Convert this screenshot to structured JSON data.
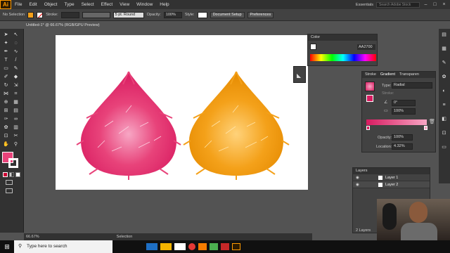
{
  "app": {
    "logo": "Ai",
    "menus": [
      "File",
      "Edit",
      "Object",
      "Type",
      "Select",
      "Effect",
      "View",
      "Window",
      "Help"
    ],
    "workspace": "Essentials",
    "search_placeholder": "Search Adobe Stock"
  },
  "control": {
    "selection": "No Selection",
    "stroke_label": "Stroke:",
    "brush": "5 pt. Round",
    "opacity_label": "Opacity:",
    "opacity": "100%",
    "style_label": "Style:",
    "doc_setup": "Document Setup",
    "preferences": "Preferences"
  },
  "document": {
    "tab": "Untitled-1* @ 66.67% (RGB/GPU Preview)",
    "zoom": "66.67%",
    "status": "Selection"
  },
  "color_panel": {
    "title": "Color",
    "hex": "AA2700"
  },
  "gradient_panel": {
    "tabs": [
      "Stroke",
      "Gradient",
      "Transparen"
    ],
    "type_label": "Type:",
    "type": "Radial",
    "stroke_label": "Stroke:",
    "angle": "0°",
    "aspect": "100%",
    "opacity_label": "Opacity:",
    "opacity": "100%",
    "location_label": "Location:",
    "location": "4.32%"
  },
  "layers_panel": {
    "title": "Layers",
    "layers": [
      "Layer 1",
      "Layer 2"
    ],
    "count": "2 Layers"
  },
  "taskbar": {
    "search": "Type here to search"
  },
  "colors": {
    "pink": "#e8437a",
    "orange": "#f4a11a",
    "accent": "#ff9a00"
  }
}
